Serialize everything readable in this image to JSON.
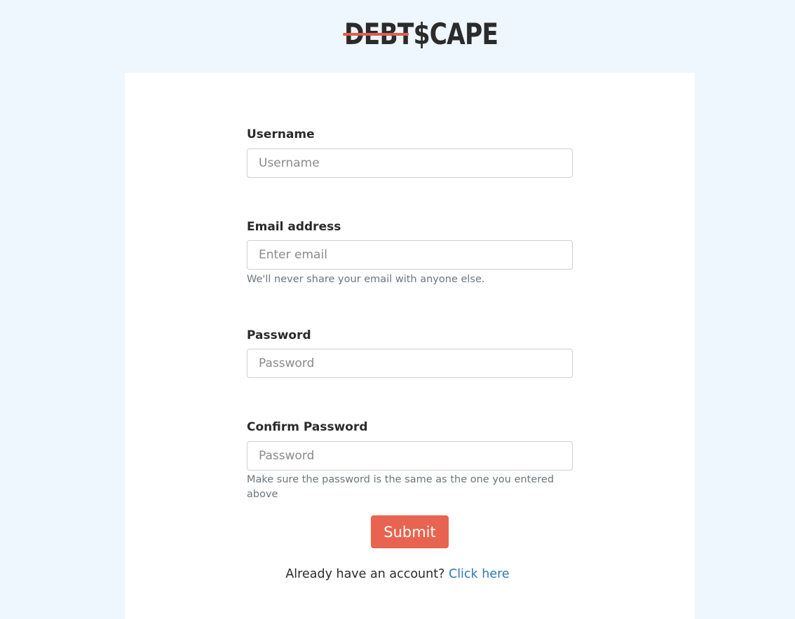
{
  "brand": {
    "logo_struck": "DEBT",
    "logo_symbol": "$",
    "logo_rest": "CAPE",
    "accent_color": "#e96351",
    "background_color": "#eef6fe"
  },
  "form": {
    "username": {
      "label": "Username",
      "placeholder": "Username",
      "value": ""
    },
    "email": {
      "label": "Email address",
      "placeholder": "Enter email",
      "value": "",
      "help": "We'll never share your email with anyone else."
    },
    "password": {
      "label": "Password",
      "placeholder": "Password",
      "value": ""
    },
    "confirm_password": {
      "label": "Confirm Password",
      "placeholder": "Password",
      "value": "",
      "help": "Make sure the password is the same as the one you entered above"
    },
    "submit_label": "Submit"
  },
  "footer": {
    "prompt": "Already have an account?",
    "link_label": "Click here",
    "link_color": "#2f78b7"
  }
}
